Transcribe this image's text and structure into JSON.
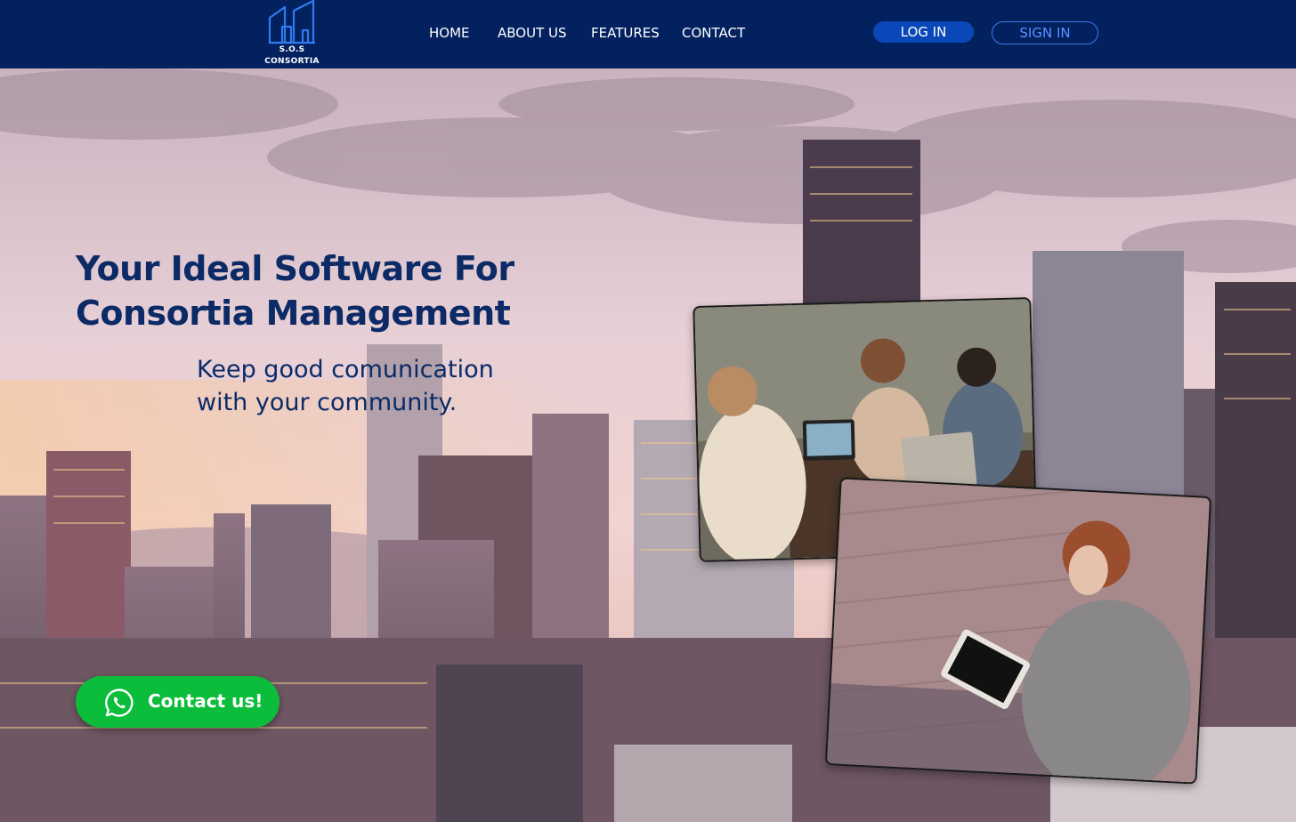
{
  "header": {
    "logo": {
      "line1": "S.O.S",
      "line2": "CONSORTIA",
      "icon": "buildings-logo-icon"
    },
    "nav": [
      {
        "label": "HOME"
      },
      {
        "label": "ABOUT US"
      },
      {
        "label": "FEATURES"
      },
      {
        "label": "CONTACT"
      }
    ],
    "login_label": "LOG IN",
    "signin_label": "SIGN IN"
  },
  "hero": {
    "headline_line1": "Your Ideal Software For",
    "headline_line2": "Consortia Management",
    "sub_line1": "Keep good comunication",
    "sub_line2": "with your community.",
    "background": "city-skyline-image",
    "photos": [
      "team-meeting-photo",
      "woman-with-tablet-photo"
    ]
  },
  "contact": {
    "label": "Contact us!",
    "icon": "whatsapp-icon"
  },
  "colors": {
    "header_bg": "#03215f",
    "primary_text": "#0b2a66",
    "login_bg": "#0a47b8",
    "signin_border": "#3d7ae8",
    "contact_bg": "#0bbd3a"
  }
}
